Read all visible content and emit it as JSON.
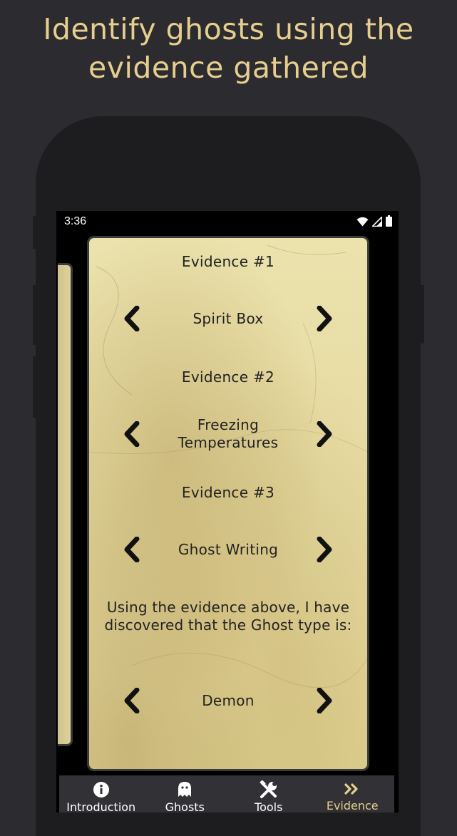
{
  "headline": {
    "line1": "Identify ghosts using the",
    "line2": "evidence gathered"
  },
  "statusbar": {
    "time": "3:36",
    "icons": [
      "wifi-icon",
      "signal-icon",
      "battery-icon"
    ]
  },
  "card": {
    "evidence": [
      {
        "title": "Evidence #1",
        "value": "Spirit Box"
      },
      {
        "title": "Evidence #2",
        "value": "Freezing Temperatures"
      },
      {
        "title": "Evidence #3",
        "value": "Ghost Writing"
      }
    ],
    "conclusion": "Using the evidence above, I have discovered that the Ghost type is:",
    "ghost_type": "Demon"
  },
  "nav": {
    "items": [
      {
        "label": "Introduction",
        "icon": "info-icon"
      },
      {
        "label": "Ghosts",
        "icon": "ghost-icon"
      },
      {
        "label": "Tools",
        "icon": "tools-icon"
      },
      {
        "label": "Evidence",
        "icon": "double-chevron-icon"
      }
    ],
    "active": "Evidence"
  },
  "colors": {
    "background": "#2c2b30",
    "accent": "#e6cf8e",
    "navbar": "#323136",
    "parchment": "#e6dba2"
  }
}
